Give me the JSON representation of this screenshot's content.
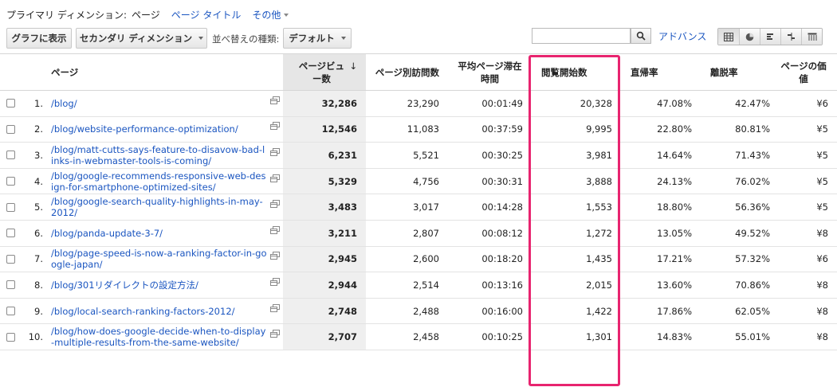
{
  "primary_dimension": {
    "label": "プライマリ ディメンション:",
    "current": "ページ",
    "links": [
      "ページ タイトル",
      "その他"
    ]
  },
  "toolbar": {
    "graph_button": "グラフに表示",
    "secondary_dimension": "セカンダリ ディメンション",
    "sort_label": "並べ替えの種類:",
    "sort_value": "デフォルト",
    "search_placeholder": "",
    "advanced": "アドバンス",
    "view_icons": [
      "table-view-icon",
      "pie-view-icon",
      "performance-view-icon",
      "comparison-view-icon",
      "pivot-view-icon"
    ]
  },
  "table": {
    "headers": {
      "page": "ページ",
      "pageviews": "ページビュー数",
      "unique_pageviews": "ページ別訪問数",
      "avg_time": "平均ページ滞在時間",
      "entrances": "閲覧開始数",
      "bounce": "直帰率",
      "exit": "離脱率",
      "value": "ページの価値"
    },
    "sort_arrow": "↓",
    "rows": [
      {
        "index": "1.",
        "page": "/blog/",
        "pageviews": "32,286",
        "unique": "23,290",
        "time": "00:01:49",
        "entrances": "20,328",
        "bounce": "47.08%",
        "exit": "42.47%",
        "value": "¥6"
      },
      {
        "index": "2.",
        "page": "/blog/website-performance-optimization/",
        "pageviews": "12,546",
        "unique": "11,083",
        "time": "00:37:59",
        "entrances": "9,995",
        "bounce": "22.80%",
        "exit": "80.81%",
        "value": "¥5"
      },
      {
        "index": "3.",
        "page": "/blog/matt-cutts-says-feature-to-disavow-bad-links-in-webmaster-tools-is-coming/",
        "pageviews": "6,231",
        "unique": "5,521",
        "time": "00:30:25",
        "entrances": "3,981",
        "bounce": "14.64%",
        "exit": "71.43%",
        "value": "¥5"
      },
      {
        "index": "4.",
        "page": "/blog/google-recommends-responsive-web-design-for-smartphone-optimized-sites/",
        "pageviews": "5,329",
        "unique": "4,756",
        "time": "00:30:31",
        "entrances": "3,888",
        "bounce": "24.13%",
        "exit": "76.02%",
        "value": "¥5"
      },
      {
        "index": "5.",
        "page": "/blog/google-search-quality-highlights-in-may-2012/",
        "pageviews": "3,483",
        "unique": "3,017",
        "time": "00:14:28",
        "entrances": "1,553",
        "bounce": "18.80%",
        "exit": "56.36%",
        "value": "¥5"
      },
      {
        "index": "6.",
        "page": "/blog/panda-update-3-7/",
        "pageviews": "3,211",
        "unique": "2,807",
        "time": "00:08:12",
        "entrances": "1,272",
        "bounce": "13.05%",
        "exit": "49.52%",
        "value": "¥8"
      },
      {
        "index": "7.",
        "page": "/blog/page-speed-is-now-a-ranking-factor-in-google-japan/",
        "pageviews": "2,945",
        "unique": "2,600",
        "time": "00:18:20",
        "entrances": "1,435",
        "bounce": "17.21%",
        "exit": "57.32%",
        "value": "¥6"
      },
      {
        "index": "8.",
        "page": "/blog/301リダイレクトの設定方法/",
        "pageviews": "2,944",
        "unique": "2,514",
        "time": "00:13:16",
        "entrances": "2,015",
        "bounce": "13.60%",
        "exit": "70.86%",
        "value": "¥8"
      },
      {
        "index": "9.",
        "page": "/blog/local-search-ranking-factors-2012/",
        "pageviews": "2,748",
        "unique": "2,488",
        "time": "00:16:00",
        "entrances": "1,422",
        "bounce": "17.86%",
        "exit": "62.05%",
        "value": "¥8"
      },
      {
        "index": "10.",
        "page": "/blog/how-does-google-decide-when-to-display-multiple-results-from-the-same-website/",
        "pageviews": "2,707",
        "unique": "2,458",
        "time": "00:10:25",
        "entrances": "1,301",
        "bounce": "14.83%",
        "exit": "55.01%",
        "value": "¥8"
      }
    ]
  },
  "colors": {
    "link": "#1a55c0",
    "highlight": "#e8246f",
    "sorted_column_bg": "#efefef"
  }
}
